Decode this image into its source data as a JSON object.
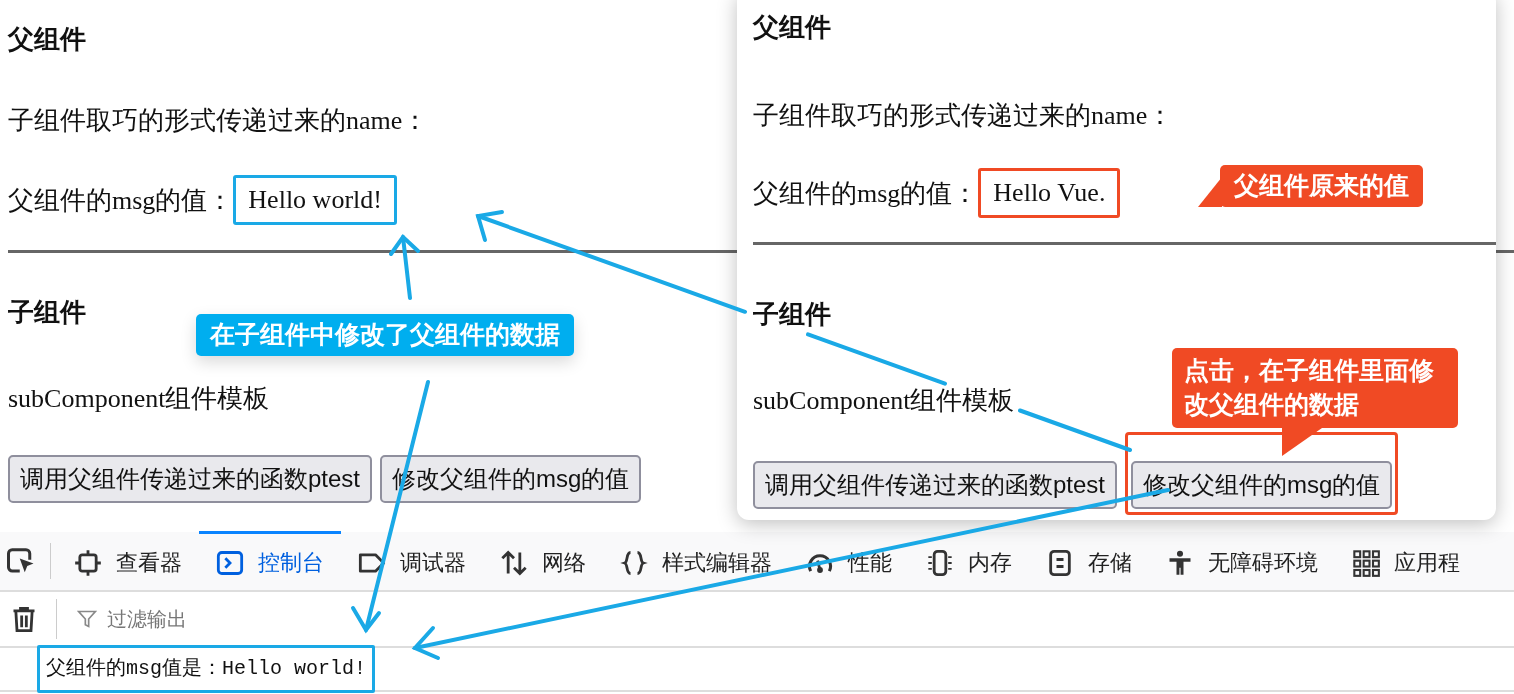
{
  "page": {
    "title": "父组件",
    "name_line": "子组件取巧的形式传递过来的name：",
    "msg_label": "父组件的msg的值：",
    "msg_value": "Hello world!",
    "msg_highlighted": true,
    "child_title": "子组件",
    "template_text": "subComponent组件模板",
    "buttons": [
      {
        "label": "调用父组件传递过来的函数ptest",
        "highlighted": false
      },
      {
        "label": "修改父组件的msg的值",
        "highlighted": false
      }
    ]
  },
  "popup": {
    "title": "父组件",
    "name_line": "子组件取巧的形式传递过来的name：",
    "msg_label": "父组件的msg的值：",
    "msg_value": "Hello Vue.",
    "msg_highlighted": true,
    "child_title": "子组件",
    "template_text": "subComponent组件模板",
    "buttons": [
      {
        "label": "调用父组件传递过来的函数ptest",
        "highlighted": false
      },
      {
        "label": "修改父组件的msg的值",
        "highlighted": true
      }
    ]
  },
  "devtools": {
    "tabs": [
      {
        "label": "查看器",
        "selected": false
      },
      {
        "label": "控制台",
        "selected": true
      },
      {
        "label": "调试器",
        "selected": false
      },
      {
        "label": "网络",
        "selected": false
      },
      {
        "label": "样式编辑器",
        "selected": false
      },
      {
        "label": "性能",
        "selected": false
      },
      {
        "label": "内存",
        "selected": false
      },
      {
        "label": "存储",
        "selected": false
      },
      {
        "label": "无障碍环境",
        "selected": false
      },
      {
        "label": "应用程",
        "selected": false
      }
    ],
    "filter": {
      "placeholder": "过滤输出"
    },
    "console_lines": [
      {
        "text": "父组件的msg值是：Hello world!",
        "highlighted": true
      }
    ]
  },
  "callouts": [
    {
      "text": "在子组件中修改了父组件的数据",
      "color": "#00aeef",
      "kind": "plain"
    },
    {
      "text": "父组件原来的值",
      "color": "#f04a24",
      "kind": "left-pointer"
    },
    {
      "text": "点击，在子组件里面修改父组件的数据",
      "color": "#f04a24",
      "kind": "down-pointer"
    }
  ]
}
